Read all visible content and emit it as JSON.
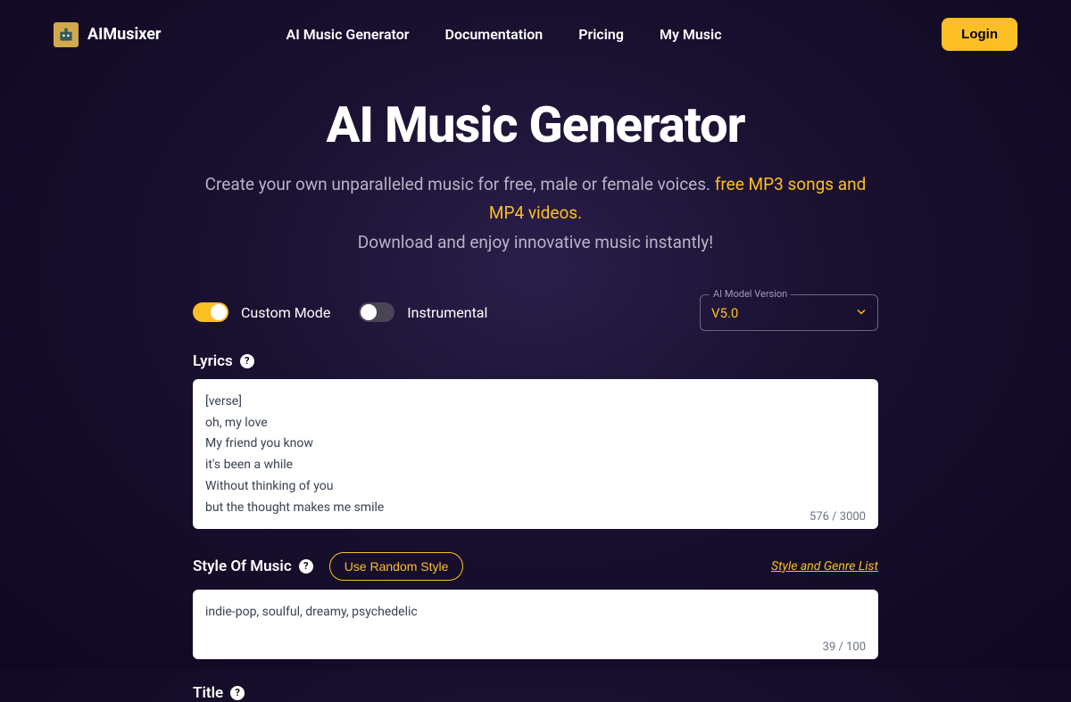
{
  "brand": "AIMusixer",
  "nav": {
    "items": [
      "AI Music Generator",
      "Documentation",
      "Pricing",
      "My Music"
    ]
  },
  "login_label": "Login",
  "hero": {
    "title": "AI Music Generator",
    "subtitle_prefix": "Create your own unparalleled music for free, male or female voices. ",
    "subtitle_highlight": "free MP3 songs and MP4 videos.",
    "subtitle_line2": "Download and enjoy innovative music instantly!"
  },
  "toggles": {
    "custom_mode_label": "Custom Mode",
    "instrumental_label": "Instrumental"
  },
  "model": {
    "label": "AI Model Version",
    "value": "V5.0"
  },
  "lyrics": {
    "label": "Lyrics",
    "value": "[verse]\noh, my love\nMy friend you know\nit's been a while\nWithout thinking of you\nbut the thought makes me smile",
    "count": "576 / 3000"
  },
  "style": {
    "label": "Style Of Music",
    "random_btn": "Use Random Style",
    "genre_link": "Style and Genre List",
    "value": "indie-pop, soulful, dreamy, psychedelic",
    "count": "39 / 100"
  },
  "title_section": {
    "label": "Title"
  }
}
